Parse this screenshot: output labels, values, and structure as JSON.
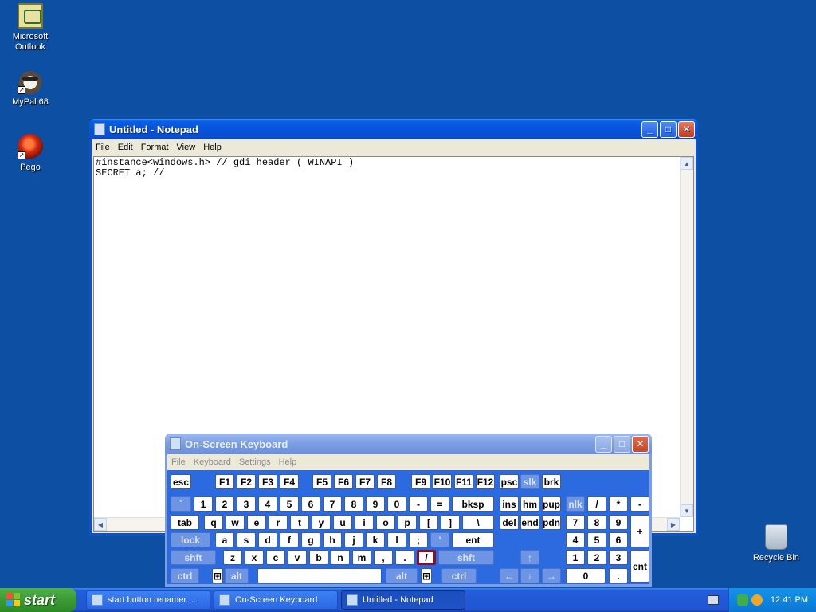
{
  "desktop": {
    "icons": [
      {
        "label": "Microsoft Outlook",
        "icon": "outlook-icon"
      },
      {
        "label": "MyPal 68",
        "icon": "mypal-icon"
      },
      {
        "label": "Pego",
        "icon": "pego-icon"
      },
      {
        "label": "Recycle Bin",
        "icon": "recycle-bin-icon"
      }
    ]
  },
  "notepad": {
    "title": "Untitled - Notepad",
    "menu": [
      "File",
      "Edit",
      "Format",
      "View",
      "Help"
    ],
    "content": "#instance<windows.h> // gdi header ( WINAPI )\nSECRET a; //"
  },
  "osk": {
    "title": "On-Screen Keyboard",
    "menu": [
      "File",
      "Keyboard",
      "Settings",
      "Help"
    ],
    "rows": {
      "fn": [
        "esc",
        "F1",
        "F2",
        "F3",
        "F4",
        "F5",
        "F6",
        "F7",
        "F8",
        "F9",
        "F10",
        "F11",
        "F12",
        "psc",
        "slk",
        "brk"
      ],
      "num": [
        "`",
        "1",
        "2",
        "3",
        "4",
        "5",
        "6",
        "7",
        "8",
        "9",
        "0",
        "-",
        "=",
        "bksp",
        "ins",
        "hm",
        "pup",
        "nlk",
        "/",
        "*",
        "-"
      ],
      "top": [
        "tab",
        "q",
        "w",
        "e",
        "r",
        "t",
        "y",
        "u",
        "i",
        "o",
        "p",
        "[",
        "]",
        "\\",
        "del",
        "end",
        "pdn",
        "7",
        "8",
        "9",
        "+"
      ],
      "home": [
        "lock",
        "a",
        "s",
        "d",
        "f",
        "g",
        "h",
        "j",
        "k",
        "l",
        ";",
        "'",
        "ent",
        "4",
        "5",
        "6"
      ],
      "bottom": [
        "shft",
        "z",
        "x",
        "c",
        "v",
        "b",
        "n",
        "m",
        ",",
        ".",
        "/",
        "shft",
        "↑",
        "1",
        "2",
        "3",
        "ent"
      ],
      "space": [
        "ctrl",
        "alt",
        "",
        "alt",
        "ctrl",
        "←",
        "↓",
        "→",
        "0",
        "."
      ]
    }
  },
  "taskbar": {
    "start_label": "start",
    "buttons": [
      {
        "label": "start button renamer ...",
        "active": false
      },
      {
        "label": "On-Screen Keyboard",
        "active": false
      },
      {
        "label": "Untitled - Notepad",
        "active": true
      }
    ],
    "clock": "12:41 PM"
  },
  "colors": {
    "desktop": "#0d4fa3",
    "titlebar": "#0553da",
    "start_green": "#3c9a33",
    "osk_key_selected_border": "#8b1020"
  }
}
